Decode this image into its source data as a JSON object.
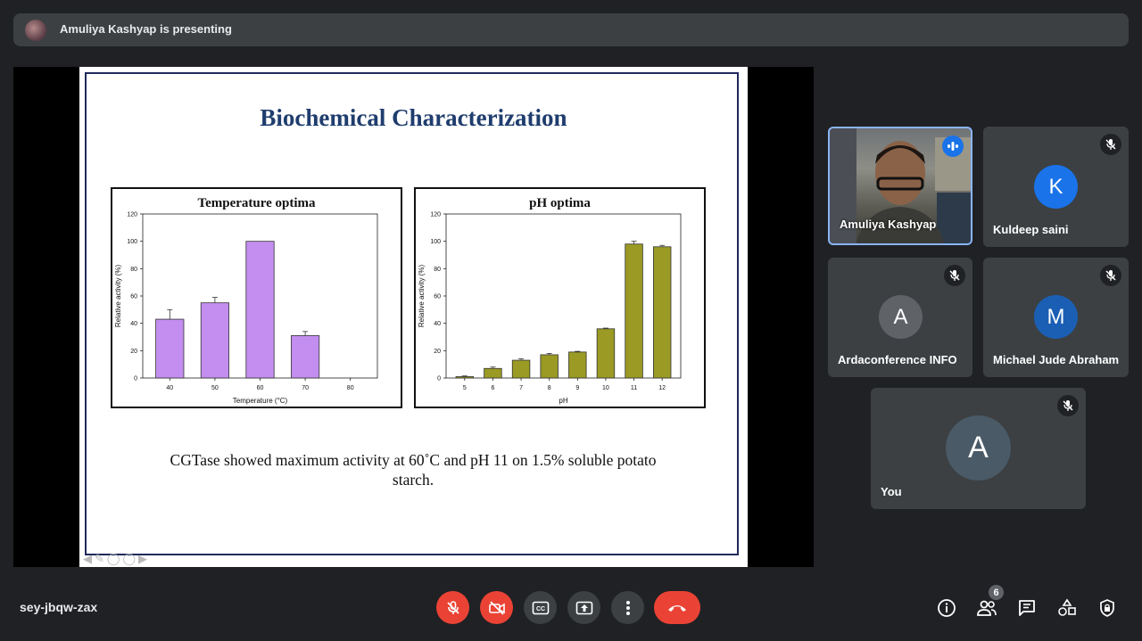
{
  "banner": {
    "text": "Amuliya Kashyap is presenting"
  },
  "slide": {
    "title": "Biochemical Characterization",
    "caption_line1": "CGTase showed maximum activity at 60˚C and pH 11 on 1.5% soluble potato",
    "caption_line2": "starch."
  },
  "chart_data": [
    {
      "type": "bar",
      "title": "Temperature optima",
      "xlabel": "Temperature (°C)",
      "ylabel": "Relative activity (%)",
      "categories": [
        "40",
        "50",
        "60",
        "70",
        "80"
      ],
      "values": [
        43,
        55,
        100,
        31,
        0
      ],
      "errors": [
        7,
        4,
        0,
        3,
        0
      ],
      "ylim": [
        0,
        120
      ],
      "yticks": [
        0,
        20,
        40,
        60,
        80,
        100,
        120
      ],
      "color": "#c38ef0"
    },
    {
      "type": "bar",
      "title": "pH optima",
      "xlabel": "pH",
      "ylabel": "Relative activity (%)",
      "categories": [
        "5",
        "6",
        "7",
        "8",
        "9",
        "10",
        "11",
        "12"
      ],
      "values": [
        1,
        7,
        13,
        17,
        19,
        36,
        98,
        96
      ],
      "errors": [
        0.5,
        1,
        1,
        1,
        0.5,
        0.5,
        2,
        1
      ],
      "ylim": [
        0,
        120
      ],
      "yticks": [
        0,
        20,
        40,
        60,
        80,
        100,
        120
      ],
      "color": "#9a9a24"
    }
  ],
  "participants": [
    {
      "name": "Amuliya Kashyap",
      "type": "video",
      "speaking": true
    },
    {
      "name": "Kuldeep saini",
      "initial": "K",
      "color": "#1a73e8",
      "muted": true
    },
    {
      "name": "Ardaconference INFO",
      "initial": "A",
      "color": "#5f6368",
      "muted": true
    },
    {
      "name": "Michael Jude Abraham",
      "initial": "M",
      "color": "#1a5fb4",
      "muted": true
    },
    {
      "name": "You",
      "initial": "A",
      "color": "#4a5a66",
      "muted": true
    }
  ],
  "meeting": {
    "code": "sey-jbqw-zax",
    "participant_count": "6"
  },
  "controls": {
    "mic_icon": "mic-off-icon",
    "cam_icon": "camera-off-icon",
    "cc_icon": "captions-icon",
    "present_icon": "present-icon",
    "more_icon": "more-vert-icon",
    "hangup_icon": "hangup-icon",
    "danger_color": "#ea4335"
  }
}
